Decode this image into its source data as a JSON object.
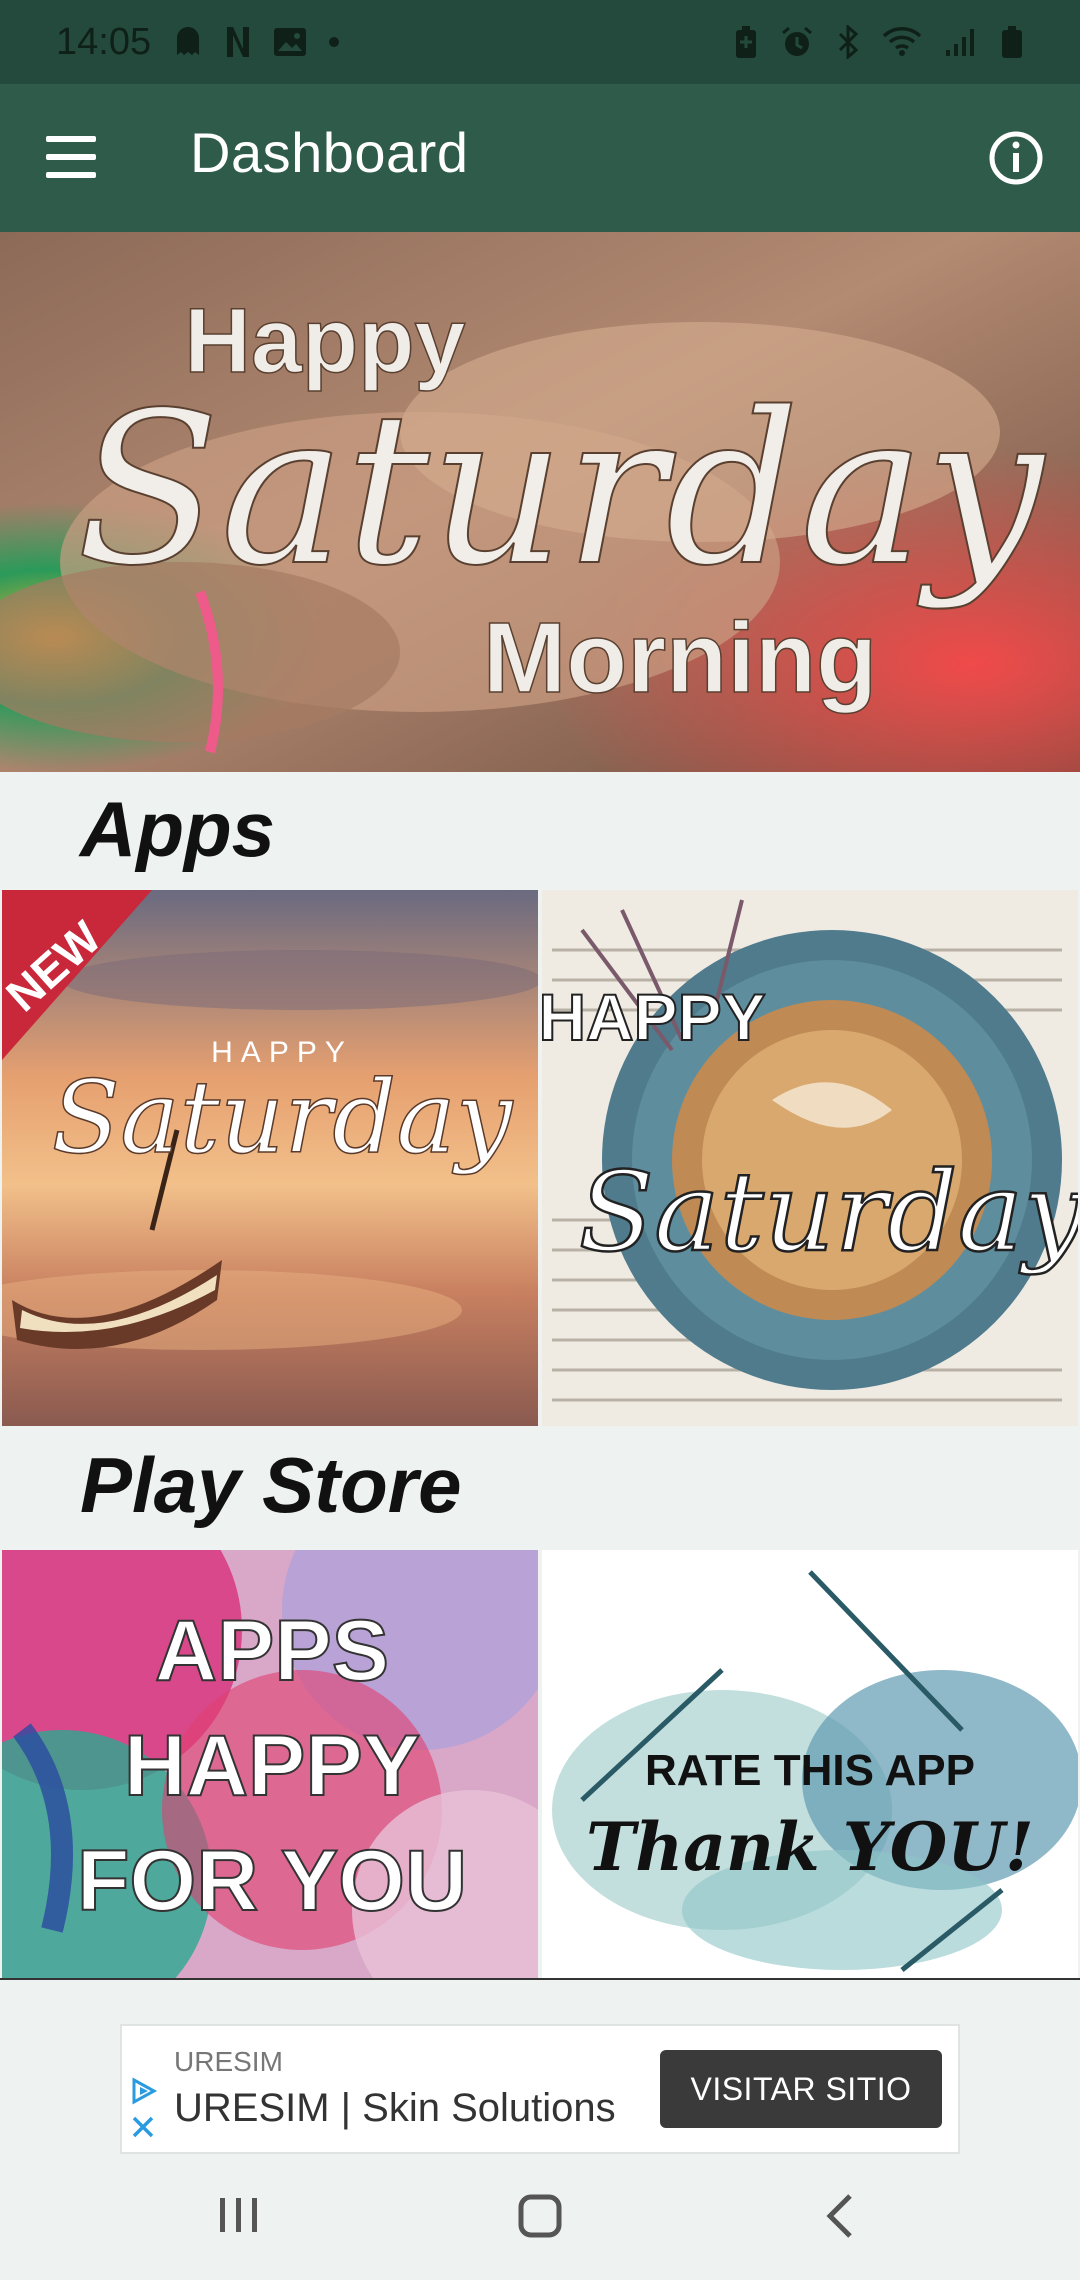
{
  "status_bar": {
    "time": "14:05",
    "left_icons": [
      "notification-ghost-icon",
      "netflix-n-icon",
      "gallery-icon",
      "dot-icon"
    ],
    "right_icons": [
      "battery-saver-icon",
      "alarm-icon",
      "bluetooth-icon",
      "wifi-icon",
      "signal-icon",
      "battery-icon"
    ]
  },
  "app_bar": {
    "title": "Dashboard",
    "menu_icon": "hamburger-menu-icon",
    "info_icon": "info-icon",
    "color": "#2f5b4b"
  },
  "hero": {
    "line1": "Happy",
    "line2": "Saturday",
    "line3": "Morning"
  },
  "sections": {
    "apps": {
      "title": "Apps",
      "tiles": [
        {
          "badge": "NEW",
          "small": "HAPPY",
          "big": "Saturday"
        },
        {
          "line1": "HAPPY",
          "line2": "Saturday"
        }
      ]
    },
    "play_store": {
      "title": "Play Store",
      "tiles": [
        {
          "line1": "APPS",
          "line2": "HAPPY",
          "line3": "FOR YOU"
        },
        {
          "line1": "RATE THIS APP",
          "line2": "Thank YOU!"
        }
      ]
    }
  },
  "ad": {
    "advertiser": "URESIM",
    "headline": "URESIM | Skin Solutions",
    "cta": "VISITAR SITIO"
  },
  "nav_bar": {
    "icons": [
      "recents-icon",
      "home-icon",
      "back-icon"
    ]
  }
}
